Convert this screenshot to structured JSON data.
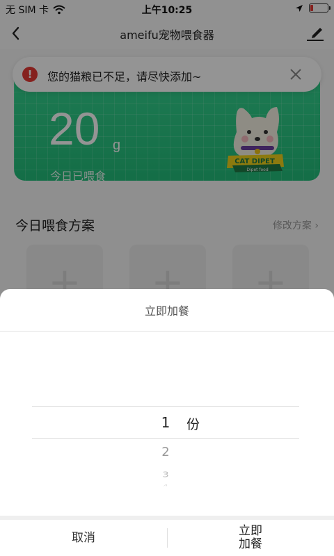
{
  "status_bar": {
    "carrier": "无 SIM 卡",
    "time": "上午10:25"
  },
  "nav": {
    "title": "ameifu宠物喂食器"
  },
  "feed_card": {
    "amount": "20",
    "unit": "g",
    "label": "今日已喂食",
    "mascot_label": "CAT DIPET",
    "mascot_sub": "Dipet food"
  },
  "alert": {
    "icon": "!",
    "text": "您的猫粮已不足，请尽快添加~"
  },
  "plan": {
    "title": "今日喂食方案",
    "edit_link": "修改方案",
    "slots": [
      "+",
      "+",
      "+"
    ]
  },
  "sheet": {
    "title": "立即加餐",
    "picker": {
      "selected": "1",
      "items_below": [
        "2",
        "3",
        "4"
      ],
      "unit": "份"
    },
    "cancel": "取消",
    "confirm_line1": "立即",
    "confirm_line2": "加餐"
  },
  "colors": {
    "brand_green": "#2ecf8a",
    "alert_red": "#e53935",
    "battery_low": "#e53935"
  },
  "battery_level": 0.15
}
